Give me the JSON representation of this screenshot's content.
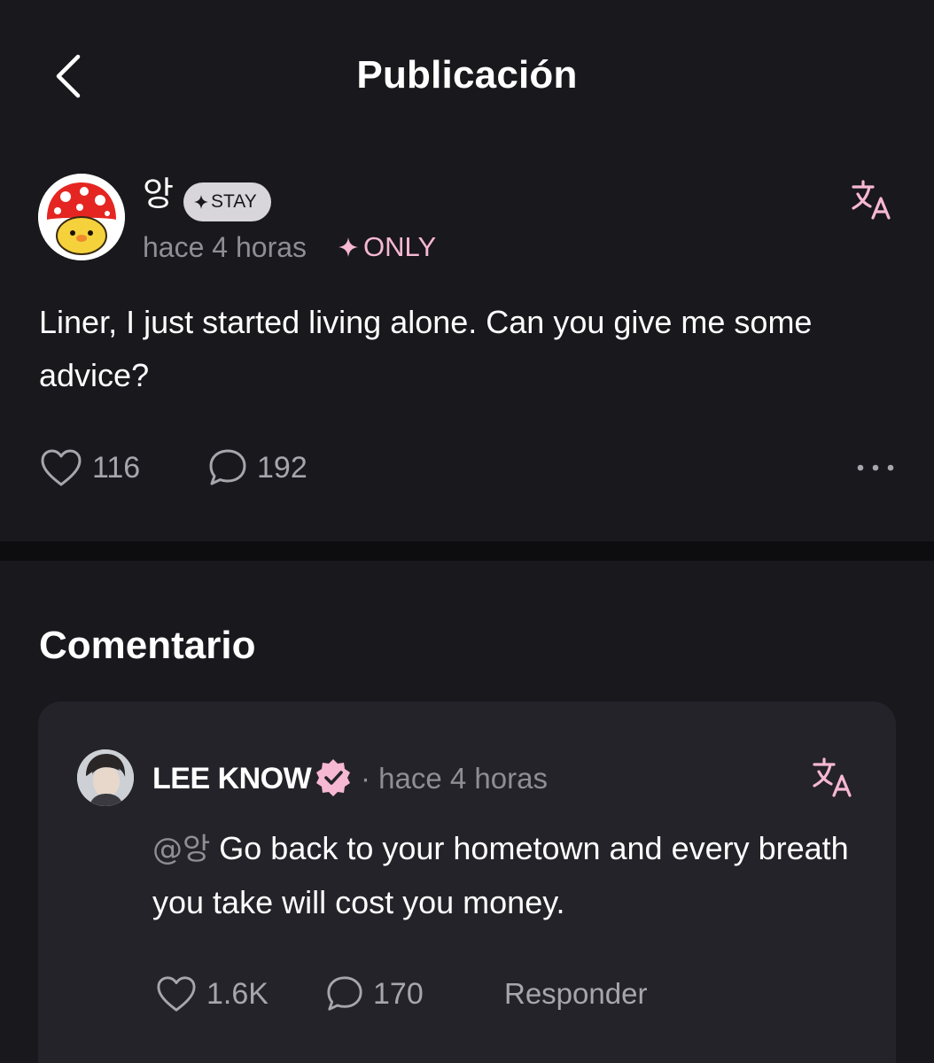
{
  "header": {
    "title": "Publicación"
  },
  "post": {
    "username": "앙",
    "badge_label": "STAY",
    "timestamp": "hace 4 horas",
    "only_label": "ONLY",
    "body": "Liner, I just started living alone. Can you give me some advice?",
    "likes": "116",
    "comments": "192"
  },
  "comments_section": {
    "title": "Comentario"
  },
  "comment": {
    "author": "LEE KNOW",
    "timestamp": "· hace 4 horas",
    "mention": "@앙",
    "body": " Go back to your hometown and every breath you take will cost you money.",
    "likes": "1.6K",
    "replies": "170",
    "reply_label": "Responder"
  },
  "icons": {
    "back": "chevron-left-icon",
    "translate": "translate-icon",
    "like": "heart-icon",
    "comment": "speech-bubble-icon",
    "more": "more-horizontal-icon",
    "verified": "verified-badge-icon",
    "sparkle": "sparkle-icon"
  },
  "colors": {
    "background": "#19181d",
    "card": "#242329",
    "divider": "#0d0d10",
    "accent_pink": "#f6b8d3",
    "muted_text": "#8f8e94"
  }
}
